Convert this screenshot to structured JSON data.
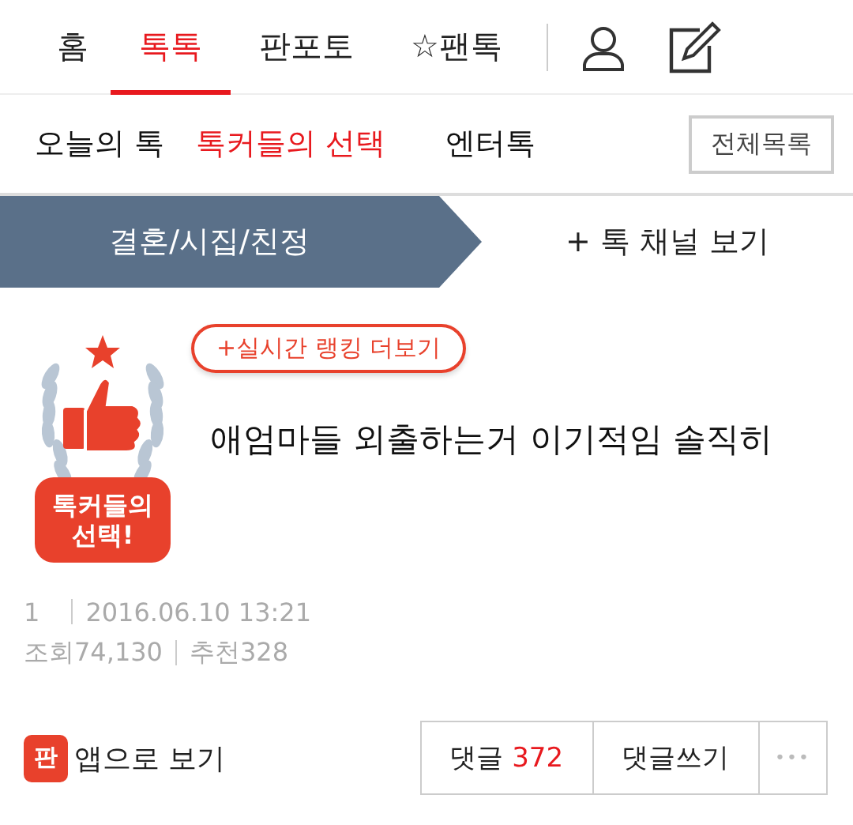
{
  "nav": {
    "tabs": [
      {
        "label": "홈",
        "selected": false
      },
      {
        "label": "톡톡",
        "selected": true
      },
      {
        "label": "판포토",
        "selected": false
      },
      {
        "label": "☆팬톡",
        "selected": false
      }
    ]
  },
  "subnav": {
    "items": [
      {
        "label": "오늘의 톡",
        "selected": false
      },
      {
        "label": "톡커들의 선택",
        "selected": true
      },
      {
        "label": "엔터톡",
        "selected": false
      }
    ],
    "all_button": "전체목록"
  },
  "channel_bar": {
    "current": "결혼/시집/친정",
    "link": "+ 톡 채널 보기"
  },
  "post": {
    "badge": [
      "톡커들의",
      "선택!"
    ],
    "ranking_link": "+실시간 랭킹 더보기",
    "title": "애엄마들 외출하는거 이기적임 솔직히",
    "number": "1",
    "date": "2016.06.10 13:21",
    "views": "조회74,130",
    "likes": "추천328"
  },
  "footer": {
    "app_icon": "판",
    "app_link": "앱으로 보기",
    "comments_label": "댓글",
    "comments_count": "372",
    "write_comment": "댓글쓰기",
    "more": "•••"
  }
}
